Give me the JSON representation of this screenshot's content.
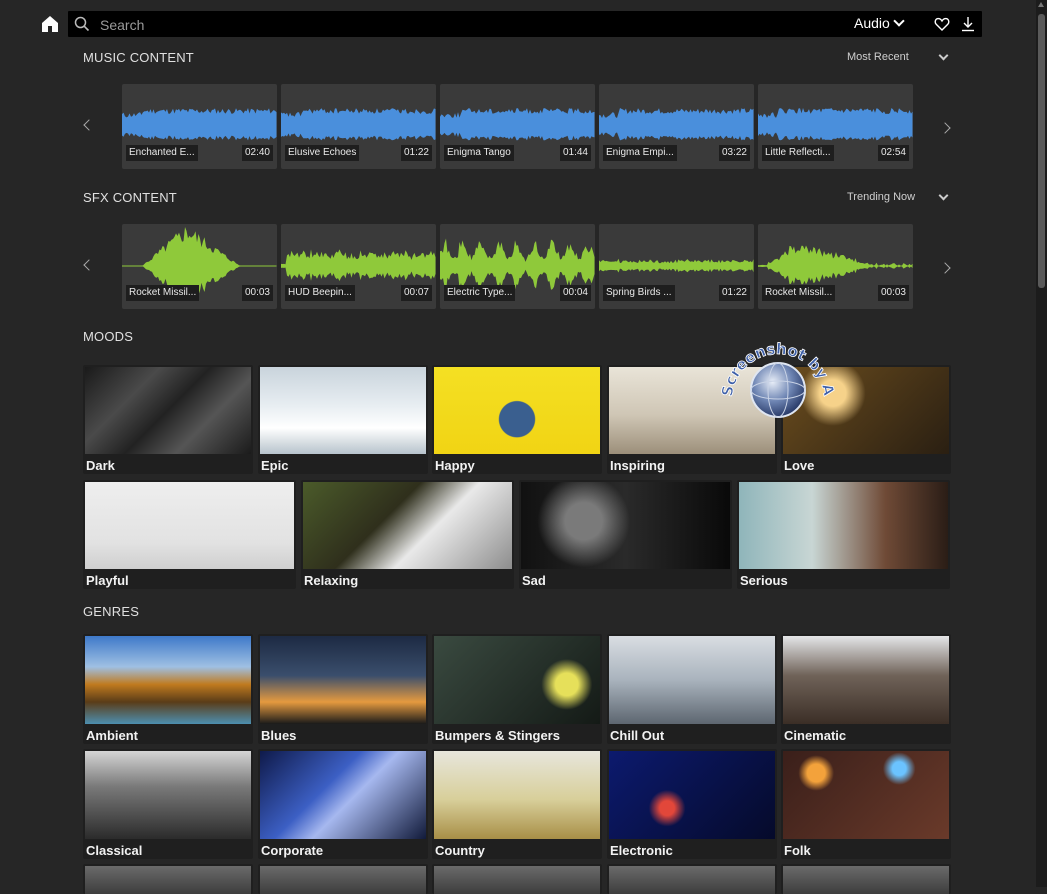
{
  "search": {
    "placeholder": "Search"
  },
  "header": {
    "audio_select": "Audio"
  },
  "music": {
    "title": "MUSIC CONTENT",
    "sort": "Most Recent",
    "tracks": [
      {
        "name": "Enchanted E...",
        "duration": "02:40"
      },
      {
        "name": "Elusive Echoes",
        "duration": "01:22"
      },
      {
        "name": "Enigma Tango",
        "duration": "01:44"
      },
      {
        "name": "Enigma Empi...",
        "duration": "03:22"
      },
      {
        "name": "Little Reflecti...",
        "duration": "02:54"
      }
    ]
  },
  "sfx": {
    "title": "SFX CONTENT",
    "sort": "Trending Now",
    "tracks": [
      {
        "name": "Rocket Missil...",
        "duration": "00:03"
      },
      {
        "name": "HUD Beepin...",
        "duration": "00:07"
      },
      {
        "name": "Electric Type...",
        "duration": "00:04"
      },
      {
        "name": "Spring Birds ...",
        "duration": "01:22"
      },
      {
        "name": "Rocket Missil...",
        "duration": "00:03"
      }
    ]
  },
  "moods": {
    "title": "MOODS",
    "row1": [
      "Dark",
      "Epic",
      "Happy",
      "Inspiring",
      "Love"
    ],
    "row2": [
      "Playful",
      "Relaxing",
      "Sad",
      "Serious"
    ]
  },
  "genres": {
    "title": "GENRES",
    "row1": [
      "Ambient",
      "Blues",
      "Bumpers & Stingers",
      "Chill Out",
      "Cinematic"
    ],
    "row2": [
      "Classical",
      "Corporate",
      "Country",
      "Electronic",
      "Folk"
    ]
  },
  "watermark": {
    "text": "Screenshot by Ahadesign.eu"
  },
  "colors": {
    "music_wave": "#4a8fdc",
    "sfx_wave": "#8fc93a",
    "background": "#262626"
  }
}
